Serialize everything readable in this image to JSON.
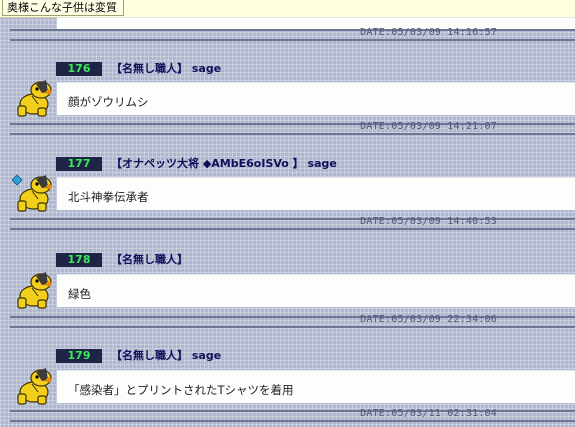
{
  "tab": {
    "title": "奥様こんな子供は変質"
  },
  "top_date": "DATE:05/03/09 14:16:57",
  "posts": [
    {
      "number": "176",
      "name": "【名無し職人】",
      "mail": "sage",
      "body": "顔がゾウリムシ",
      "date": "DATE:05/03/09 14:21:07",
      "icon": "dog-icon"
    },
    {
      "number": "177",
      "name": "【オナペッツ大将 ◆AMbE6oISVo 】",
      "mail": "sage",
      "body": "北斗神拳伝承者",
      "date": "DATE:05/03/09 14:40:53",
      "icon": "dog-icon-blue-badge"
    },
    {
      "number": "178",
      "name": "【名無し職人】",
      "mail": "",
      "body": "緑色",
      "date": "DATE:05/03/09 22:34:06",
      "icon": "dog-icon"
    },
    {
      "number": "179",
      "name": "【名無し職人】",
      "mail": "sage",
      "body": "「感染者」とプリントされたTシャツを着用",
      "date": "DATE:05/03/11 02:31:04",
      "icon": "dog-icon"
    }
  ],
  "colors": {
    "background": "#aeb6d0",
    "number_bg": "#1d2547",
    "number_fg": "#3fe85a",
    "name_fg": "#10105a",
    "icon_yellow": "#f2cf1d"
  }
}
